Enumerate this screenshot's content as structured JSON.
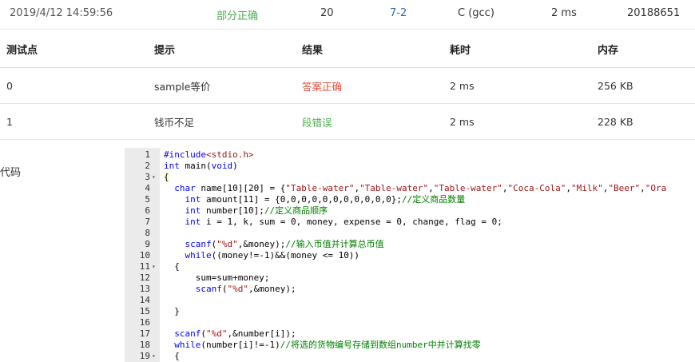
{
  "summary": {
    "time": "2019/4/12 14:59:56",
    "status": "部分正确",
    "score": "20",
    "problem": "7-2",
    "language": "C (gcc)",
    "duration": "2 ms",
    "user": "20188651"
  },
  "table": {
    "headers": [
      "测试点",
      "提示",
      "结果",
      "耗时",
      "内存"
    ],
    "rows": [
      {
        "id": "0",
        "hint": "sample等价",
        "result": "答案正确",
        "time": "2 ms",
        "memory": "256 KB"
      },
      {
        "id": "1",
        "hint": "钱币不足",
        "result": "段错误",
        "time": "2 ms",
        "memory": "228 KB"
      }
    ]
  },
  "code_label": "代码",
  "colors": {
    "accepted": "#e34d3b",
    "partial": "#4caf50",
    "link": "#2a6db5"
  },
  "code": {
    "lines": [
      {
        "n": "1",
        "fold": "",
        "parts": [
          {
            "t": "#include",
            "c": "kw"
          },
          {
            "t": "<stdio.h>",
            "c": "str"
          }
        ]
      },
      {
        "n": "2",
        "fold": "",
        "parts": [
          {
            "t": "int",
            "c": "kw"
          },
          {
            "t": " main(",
            "c": ""
          },
          {
            "t": "void",
            "c": "kw"
          },
          {
            "t": ")",
            "c": ""
          }
        ]
      },
      {
        "n": "3",
        "fold": "▾",
        "parts": [
          {
            "t": "{",
            "c": ""
          }
        ]
      },
      {
        "n": "4",
        "fold": "",
        "parts": [
          {
            "t": "  ",
            "c": ""
          },
          {
            "t": "char",
            "c": "kw"
          },
          {
            "t": " name[10][20] = {",
            "c": ""
          },
          {
            "t": "\"Table-water\"",
            "c": "str"
          },
          {
            "t": ",",
            "c": ""
          },
          {
            "t": "\"Table-water\"",
            "c": "str"
          },
          {
            "t": ",",
            "c": ""
          },
          {
            "t": "\"Table-water\"",
            "c": "str"
          },
          {
            "t": ",",
            "c": ""
          },
          {
            "t": "\"Coca-Cola\"",
            "c": "str"
          },
          {
            "t": ",",
            "c": ""
          },
          {
            "t": "\"Milk\"",
            "c": "str"
          },
          {
            "t": ",",
            "c": ""
          },
          {
            "t": "\"Beer\"",
            "c": "str"
          },
          {
            "t": ",",
            "c": ""
          },
          {
            "t": "\"Ora",
            "c": "str"
          }
        ]
      },
      {
        "n": "5",
        "fold": "",
        "parts": [
          {
            "t": "    ",
            "c": ""
          },
          {
            "t": "int",
            "c": "kw"
          },
          {
            "t": " amount[11] = {0,0,0,0,0,0,0,0,0,0,0};",
            "c": ""
          },
          {
            "t": "//定义商品数量",
            "c": "cm"
          }
        ]
      },
      {
        "n": "6",
        "fold": "",
        "parts": [
          {
            "t": "    ",
            "c": ""
          },
          {
            "t": "int",
            "c": "kw"
          },
          {
            "t": " number[10];",
            "c": ""
          },
          {
            "t": "//定义商品顺序",
            "c": "cm"
          }
        ]
      },
      {
        "n": "7",
        "fold": "",
        "parts": [
          {
            "t": "    ",
            "c": ""
          },
          {
            "t": "int",
            "c": "kw"
          },
          {
            "t": " i = 1, k, sum = 0, money, expense = 0, change, flag = 0;",
            "c": ""
          }
        ]
      },
      {
        "n": "8",
        "fold": "",
        "parts": [
          {
            "t": "",
            "c": ""
          }
        ]
      },
      {
        "n": "9",
        "fold": "",
        "parts": [
          {
            "t": "    ",
            "c": ""
          },
          {
            "t": "scanf",
            "c": "kw"
          },
          {
            "t": "(",
            "c": ""
          },
          {
            "t": "\"%d\"",
            "c": "str"
          },
          {
            "t": ",&money);",
            "c": ""
          },
          {
            "t": "//输入币值并计算总币值",
            "c": "cm"
          }
        ]
      },
      {
        "n": "10",
        "fold": "",
        "parts": [
          {
            "t": "    ",
            "c": ""
          },
          {
            "t": "while",
            "c": "kw"
          },
          {
            "t": "((money!=-1)&&(money <= 10))",
            "c": ""
          }
        ]
      },
      {
        "n": "11",
        "fold": "▾",
        "parts": [
          {
            "t": "  {",
            "c": ""
          }
        ]
      },
      {
        "n": "12",
        "fold": "",
        "parts": [
          {
            "t": "      sum=sum+money;",
            "c": ""
          }
        ]
      },
      {
        "n": "13",
        "fold": "",
        "parts": [
          {
            "t": "      ",
            "c": ""
          },
          {
            "t": "scanf",
            "c": "kw"
          },
          {
            "t": "(",
            "c": ""
          },
          {
            "t": "\"%d\"",
            "c": "str"
          },
          {
            "t": ",&money);",
            "c": ""
          }
        ]
      },
      {
        "n": "14",
        "fold": "",
        "parts": [
          {
            "t": "",
            "c": ""
          }
        ]
      },
      {
        "n": "15",
        "fold": "",
        "parts": [
          {
            "t": "  }",
            "c": ""
          }
        ]
      },
      {
        "n": "16",
        "fold": "",
        "parts": [
          {
            "t": "",
            "c": ""
          }
        ]
      },
      {
        "n": "17",
        "fold": "",
        "parts": [
          {
            "t": "  ",
            "c": ""
          },
          {
            "t": "scanf",
            "c": "kw"
          },
          {
            "t": "(",
            "c": ""
          },
          {
            "t": "\"%d\"",
            "c": "str"
          },
          {
            "t": ",&number[i]);",
            "c": ""
          }
        ]
      },
      {
        "n": "18",
        "fold": "",
        "parts": [
          {
            "t": "  ",
            "c": ""
          },
          {
            "t": "while",
            "c": "kw"
          },
          {
            "t": "(number[i]!=-1)",
            "c": ""
          },
          {
            "t": "//将选的货物编号存储到数组number中并计算找零",
            "c": "cm"
          }
        ]
      },
      {
        "n": "19",
        "fold": "▾",
        "parts": [
          {
            "t": "  {",
            "c": ""
          }
        ]
      }
    ]
  }
}
